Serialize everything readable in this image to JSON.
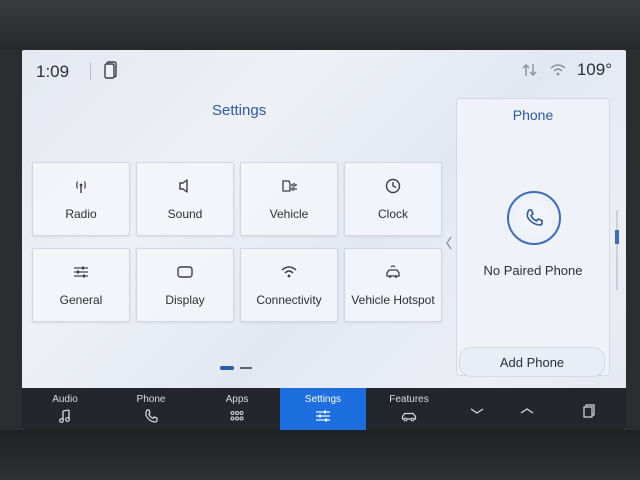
{
  "status_bar": {
    "time": "1:09",
    "temperature": "109°"
  },
  "settings": {
    "title": "Settings",
    "tiles": [
      {
        "label": "Radio",
        "icon": "radio-antenna-icon"
      },
      {
        "label": "Sound",
        "icon": "speaker-icon"
      },
      {
        "label": "Vehicle",
        "icon": "vehicle-settings-icon"
      },
      {
        "label": "Clock",
        "icon": "clock-icon"
      },
      {
        "label": "General",
        "icon": "sliders-icon"
      },
      {
        "label": "Display",
        "icon": "display-icon"
      },
      {
        "label": "Connectivity",
        "icon": "wifi-icon"
      },
      {
        "label": "Vehicle Hotspot",
        "icon": "vehicle-hotspot-icon"
      }
    ],
    "page_index": 1,
    "page_count": 2
  },
  "phone_panel": {
    "title": "Phone",
    "status": "No Paired Phone",
    "add_label": "Add Phone"
  },
  "nav_bar": {
    "items": [
      {
        "label": "Audio",
        "icon": "music-note-icon",
        "active": false
      },
      {
        "label": "Phone",
        "icon": "phone-icon",
        "active": false
      },
      {
        "label": "Apps",
        "icon": "apps-grid-icon",
        "active": false
      },
      {
        "label": "Settings",
        "icon": "sliders-icon",
        "active": true
      },
      {
        "label": "Features",
        "icon": "car-icon",
        "active": false
      },
      {
        "label": "",
        "icon": "chevron-down-icon",
        "active": false
      },
      {
        "label": "",
        "icon": "chevron-up-icon",
        "active": false
      },
      {
        "label": "",
        "icon": "copy-windows-icon",
        "active": false
      }
    ]
  },
  "colors": {
    "accent": "#2a5aa8",
    "active_tab": "#1d6fe0",
    "nav_background": "#23262c"
  }
}
